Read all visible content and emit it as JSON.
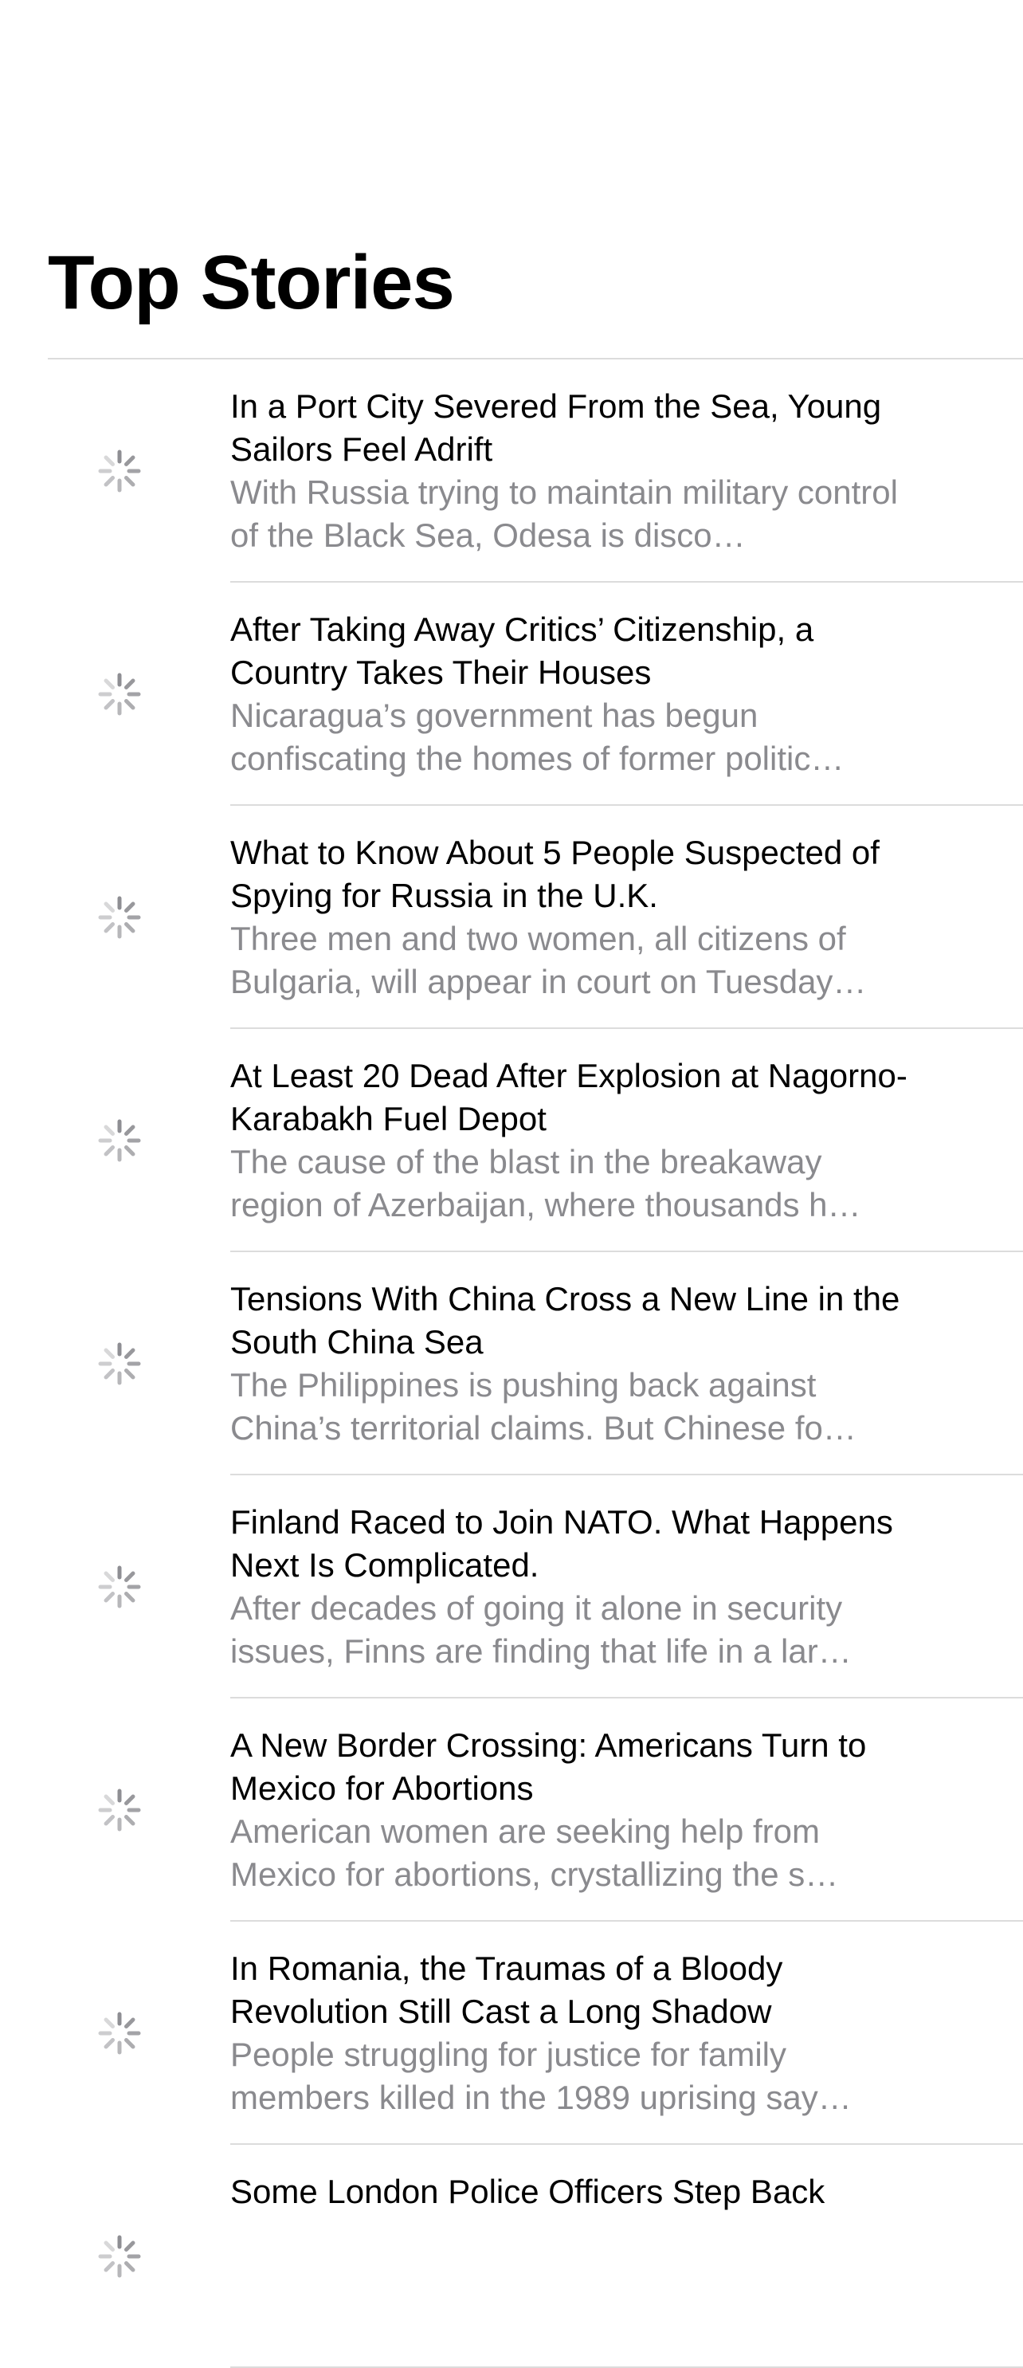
{
  "header": {
    "title": "Top Stories"
  },
  "stories": [
    {
      "title": "In a Port City Severed From the Sea, Young Sailors Feel Adrift",
      "summary": "With Russia trying to maintain military control of the Black Sea, Odesa is disco…"
    },
    {
      "title": "After Taking Away Critics’ Citizenship, a Country Takes Their Houses",
      "summary": "Nicaragua’s government has begun confiscating the homes of former politic…"
    },
    {
      "title": "What to Know About 5 People Suspected of Spying for Russia in the U.K.",
      "summary": "Three men and two women, all citizens of Bulgaria, will appear in court on Tuesday…"
    },
    {
      "title": "At Least 20 Dead After Explosion at Nagorno-Karabakh Fuel Depot",
      "summary": "The cause of the blast in the breakaway region of Azerbaijan, where thousands h…"
    },
    {
      "title": "Tensions With China Cross a New Line in the South China Sea",
      "summary": "The Philippines is pushing back against China’s territorial claims. But Chinese fo…"
    },
    {
      "title": "Finland Raced to Join NATO. What Happens Next Is Complicated.",
      "summary": "After decades of going it alone in security issues, Finns are finding that life in a lar…"
    },
    {
      "title": "A New Border Crossing: Americans Turn to Mexico for Abortions",
      "summary": "American women are seeking help from Mexico for abortions, crystallizing the s…"
    },
    {
      "title": "In Romania, the Traumas of a Bloody Revolution Still Cast a Long Shadow",
      "summary": "People struggling for justice for family members killed in the 1989 uprising say…"
    },
    {
      "title": "Some London Police Officers Step Back",
      "summary": ""
    }
  ],
  "icons": {
    "thumbnail_placeholder": "loading-spinner-icon"
  },
  "colors": {
    "background": "#ffffff",
    "title_text": "#000000",
    "summary_text": "#8a8a8e",
    "divider": "#dcdcdc",
    "spinner": "#8e8e93"
  }
}
